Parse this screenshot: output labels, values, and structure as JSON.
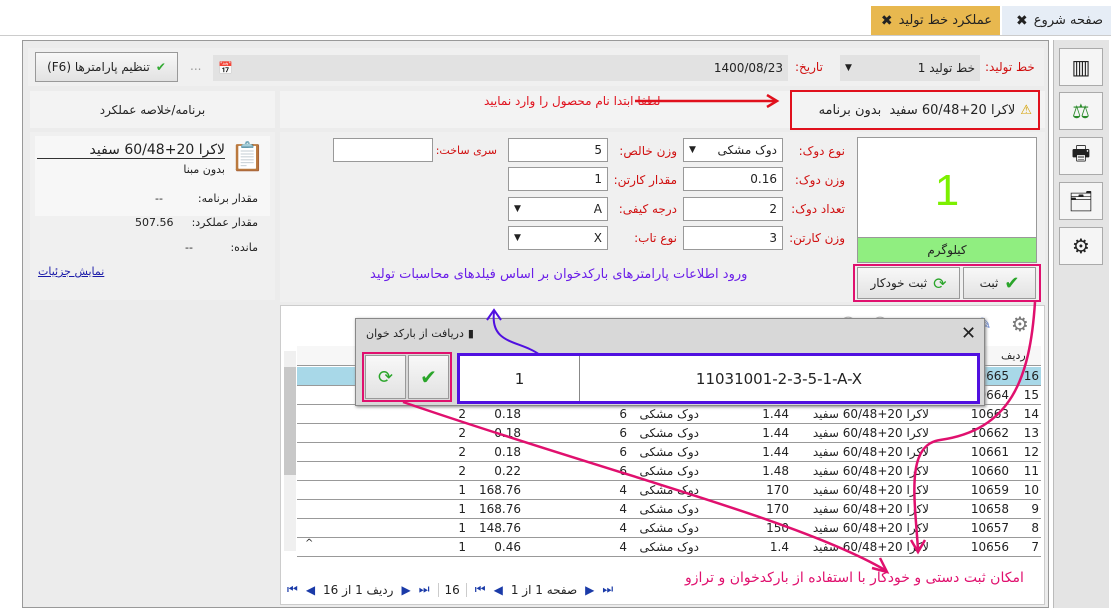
{
  "tabs": [
    {
      "label": "صفحه شروع",
      "active": false
    },
    {
      "label": "عملکرد خط تولید",
      "active": true
    }
  ],
  "toolbar": {
    "line_label": "خط تولید:",
    "line_value": "خط تولید 1",
    "date_label": "تاریخ:",
    "date_value": "1400/08/23",
    "dots": "...",
    "params_button": "تنظیم پارامترها (F6)"
  },
  "product_banner": {
    "text": "لاکرا 20+60/48 سفید  بدون برنامه",
    "hint": "لطفا ابتدا نام محصول را وارد نمایید"
  },
  "summary": {
    "header": "برنامه/خلاصه عملکرد",
    "product": "لاکرا 20+60/48 سفید",
    "basis": "بدون مبنا",
    "plan_label": "مقدار برنامه:",
    "plan_value": "--",
    "perf_label": "مقدار عملکرد:",
    "perf_value": "507.56",
    "remain_label": "مانده:",
    "remain_value": "--",
    "details_link": "نمایش جزئیات"
  },
  "scale": {
    "value": "1",
    "unit": "کیلوگرم"
  },
  "buttons": {
    "submit": "ثبت",
    "auto_submit": "ثبت خودکار"
  },
  "form": {
    "spool_type_label": "نوع دوک:",
    "spool_type": "دوک مشکی",
    "spool_weight_label": "وزن دوک:",
    "spool_weight": "0.16",
    "spool_count_label": "تعداد دوک:",
    "spool_count": "2",
    "carton_weight_label": "وزن کارتن:",
    "carton_weight": "3",
    "net_weight_label": "وزن خالص:",
    "net_weight": "5",
    "carton_qty_label": "مقدار کارتن:",
    "carton_qty": "1",
    "quality_label": "درجه کیفی:",
    "quality": "A",
    "twist_label": "نوع تاب:",
    "twist": "X",
    "batch_label": "سری ساخت:",
    "batch": ""
  },
  "barcode_note": "ورود اطلاعات پارامترهای بارکدخوان بر اساس فیلدهای محاسبات تولید",
  "popup": {
    "title": "دریافت از بارکد خوان",
    "quantity": "1",
    "barcode": "11031001-2-3-5-1-A-X"
  },
  "table": {
    "header_row": "ردیف",
    "rows": [
      [
        "16",
        "10665",
        "",
        "",
        "",
        "",
        "",
        "",
        ""
      ],
      [
        "15",
        "10664",
        "",
        "",
        "",
        "",
        "",
        "",
        ""
      ],
      [
        "14",
        "10663",
        "لاکرا 20+60/48 سفید",
        "1.44",
        "دوک مشکی",
        "6",
        "0.18",
        "2"
      ],
      [
        "13",
        "10662",
        "لاکرا 20+60/48 سفید",
        "1.44",
        "دوک مشکی",
        "6",
        "0.18",
        "2"
      ],
      [
        "12",
        "10661",
        "لاکرا 20+60/48 سفید",
        "1.44",
        "دوک مشکی",
        "6",
        "0.18",
        "2"
      ],
      [
        "11",
        "10660",
        "لاکرا 20+60/48 سفید",
        "1.48",
        "دوک مشکی",
        "6",
        "0.22",
        "2"
      ],
      [
        "10",
        "10659",
        "لاکرا 20+60/48 سفید",
        "170",
        "دوک مشکی",
        "4",
        "168.76",
        "1"
      ],
      [
        "9",
        "10658",
        "لاکرا 20+60/48 سفید",
        "170",
        "دوک مشکی",
        "4",
        "168.76",
        "1"
      ],
      [
        "8",
        "10657",
        "لاکرا 20+60/48 سفید",
        "150",
        "دوک مشکی",
        "4",
        "148.76",
        "1"
      ],
      [
        "7",
        "10656",
        "لاکرا 20+60/48 سفید",
        "1.4",
        "دوک مشکی",
        "4",
        "0.46",
        "1"
      ]
    ]
  },
  "pager": {
    "page_text": "صفحه 1 از 1",
    "total": "16",
    "row_text": "ردیف 1 از 16"
  },
  "annotation": "امکان ثبت دستی و خودکار با استفاده از بارکدخوان و ترازو",
  "colors": {
    "active_tab": "#e8b84f",
    "scale_green": "#90ee80",
    "highlight_row": "#a8d8e8",
    "annotation_pink": "#e0106e",
    "note_purple": "#6a1ee8"
  }
}
